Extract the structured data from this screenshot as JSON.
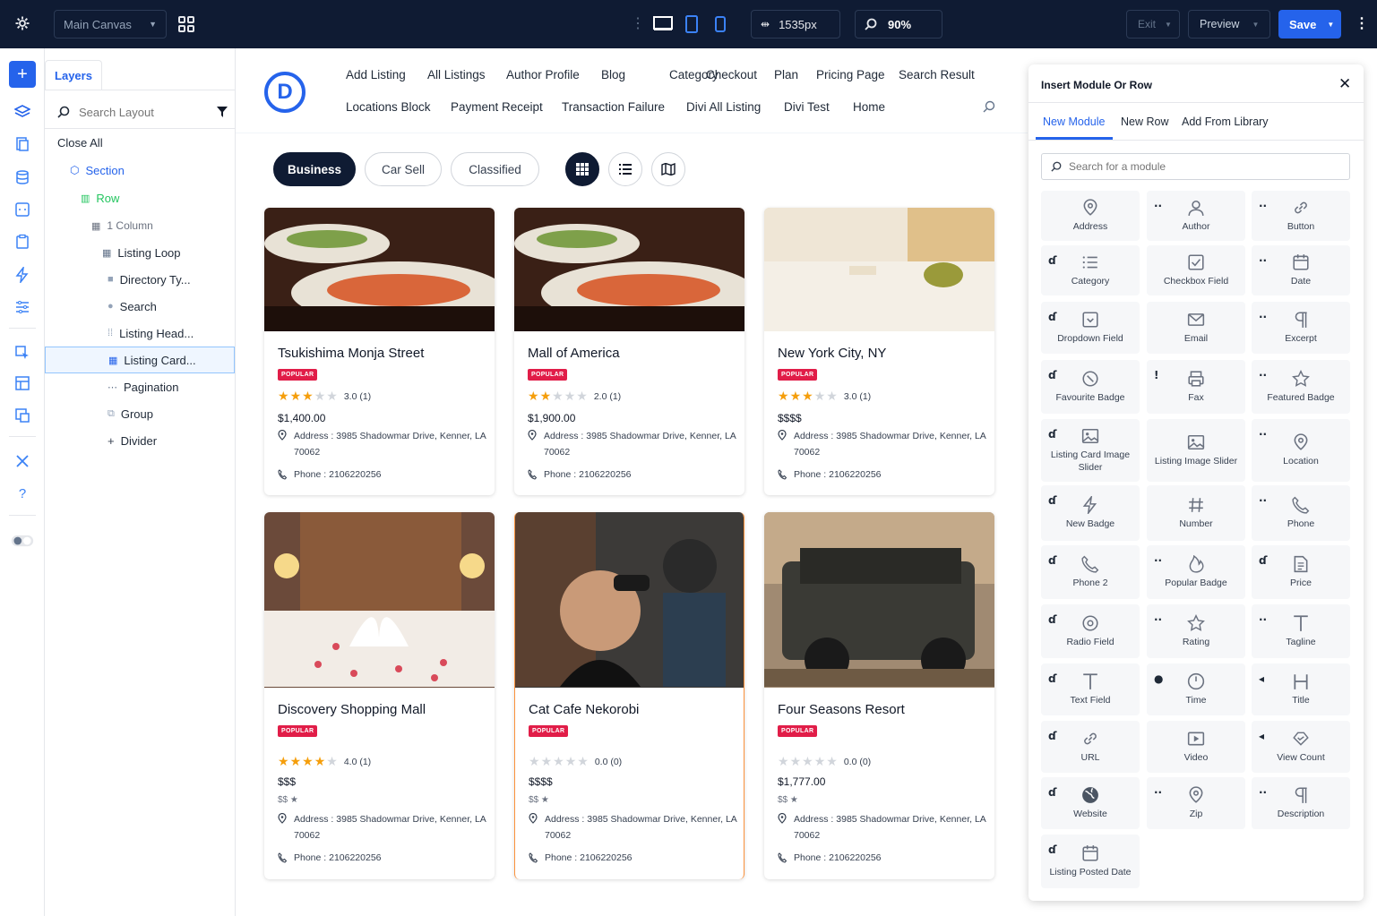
{
  "topbar": {
    "canvas_name": "Main Canvas",
    "width_value": "1535px",
    "zoom_value": "90%",
    "exit_label": "Exit",
    "preview_label": "Preview",
    "save_label": "Save"
  },
  "layers": {
    "tab_label": "Layers",
    "search_placeholder": "Search Layout",
    "close_all": "Close All",
    "items": [
      {
        "label": "Section"
      },
      {
        "label": "Row"
      },
      {
        "label": "1 Column"
      },
      {
        "label": "Listing Loop"
      },
      {
        "label": "Directory Ty..."
      },
      {
        "label": "Search"
      },
      {
        "label": "Listing Head..."
      },
      {
        "label": "Listing Card..."
      },
      {
        "label": "Pagination"
      },
      {
        "label": "Group"
      },
      {
        "label": "Divider"
      }
    ]
  },
  "logo": {
    "letter": "D"
  },
  "nav": {
    "row1": [
      "Add Listing",
      "All Listings",
      "Author Profile",
      "Blog",
      "Category",
      "Checkout",
      "Plan",
      "Pricing Page",
      "Search Result"
    ],
    "row2": [
      "Locations Block",
      "Payment Receipt",
      "Transaction Failure",
      "Divi All Listing",
      "Divi Test",
      "Home"
    ]
  },
  "filters": {
    "pills": [
      "Business",
      "Car Sell",
      "Classified"
    ]
  },
  "cards": [
    {
      "title": "Tsukishima Monja Street",
      "badge": "POPULAR",
      "rating": 3,
      "rating_text": "3.0 (1)",
      "price": "$1,400.00",
      "address": "Address : 3985 Shadowmar Drive, Kenner, LA 70062",
      "phone": "Phone : 2106220256"
    },
    {
      "title": "Mall of America",
      "badge": "POPULAR",
      "rating": 2,
      "rating_text": "2.0 (1)",
      "price": "$1,900.00",
      "address": "Address : 3985 Shadowmar Drive, Kenner, LA 70062",
      "phone": "Phone : 2106220256"
    },
    {
      "title": "New York City, NY",
      "badge": "POPULAR",
      "rating": 3,
      "rating_text": "3.0 (1)",
      "price": "$$$$",
      "address": "Address : 3985 Shadowmar Drive, Kenner, LA 70062",
      "phone": "Phone : 2106220256"
    },
    {
      "title": "Discovery Shopping Mall",
      "badge": "POPULAR",
      "rating": 4,
      "rating_text": "4.0 (1)",
      "price": "$$$",
      "price2": "$$ ★",
      "address": "Address : 3985 Shadowmar Drive, Kenner, LA 70062",
      "phone": "Phone : 2106220256"
    },
    {
      "title": "Cat Cafe Nekorobi",
      "badge": "POPULAR",
      "rating": 0,
      "rating_text": "0.0 (0)",
      "price": "$$$$",
      "price2": "$$ ★",
      "address": "Address : 3985 Shadowmar Drive, Kenner, LA 70062",
      "phone": "Phone : 2106220256"
    },
    {
      "title": "Four Seasons Resort",
      "badge": "POPULAR",
      "rating": 0,
      "rating_text": "0.0 (0)",
      "price": "$1,777.00",
      "price2": "$$ ★",
      "address": "Address : 3985 Shadowmar Drive, Kenner, LA 70062",
      "phone": "Phone : 2106220256"
    }
  ],
  "insert": {
    "title": "Insert Module Or Row",
    "tabs": [
      "New Module",
      "New Row",
      "Add From Library"
    ],
    "search_placeholder": "Search for a module",
    "modules": [
      {
        "label": "Address",
        "icon": "pin-icon"
      },
      {
        "label": "Author",
        "icon": "user-icon"
      },
      {
        "label": "Button",
        "icon": "link-icon"
      },
      {
        "label": "Category",
        "icon": "list-icon"
      },
      {
        "label": "Checkbox Field",
        "icon": "checkbox-icon"
      },
      {
        "label": "Date",
        "icon": "calendar-icon"
      },
      {
        "label": "Dropdown Field",
        "icon": "dropdown-icon"
      },
      {
        "label": "Email",
        "icon": "mail-icon"
      },
      {
        "label": "Excerpt",
        "icon": "paragraph-icon"
      },
      {
        "label": "Favourite Badge",
        "icon": "badge-icon"
      },
      {
        "label": "Fax",
        "icon": "printer-icon"
      },
      {
        "label": "Featured Badge",
        "icon": "star-icon"
      },
      {
        "label": "Listing Card Image Slider",
        "icon": "image-icon"
      },
      {
        "label": "Listing Image Slider",
        "icon": "image-icon"
      },
      {
        "label": "Location",
        "icon": "pin-icon"
      },
      {
        "label": "New Badge",
        "icon": "bolt-icon"
      },
      {
        "label": "Number",
        "icon": "hash-icon"
      },
      {
        "label": "Phone",
        "icon": "phone-icon"
      },
      {
        "label": "Phone 2",
        "icon": "phone-icon"
      },
      {
        "label": "Popular Badge",
        "icon": "fire-icon"
      },
      {
        "label": "Price",
        "icon": "document-icon"
      },
      {
        "label": "Radio Field",
        "icon": "radio-icon"
      },
      {
        "label": "Rating",
        "icon": "star-icon"
      },
      {
        "label": "Tagline",
        "icon": "text-icon"
      },
      {
        "label": "Text Field",
        "icon": "text-icon"
      },
      {
        "label": "Time",
        "icon": "clock-icon"
      },
      {
        "label": "Title",
        "icon": "heading-icon"
      },
      {
        "label": "URL",
        "icon": "link-icon"
      },
      {
        "label": "Video",
        "icon": "video-icon"
      },
      {
        "label": "View Count",
        "icon": "eye-icon"
      },
      {
        "label": "Website",
        "icon": "globe-icon"
      },
      {
        "label": "Zip",
        "icon": "pin-icon"
      },
      {
        "label": "Description",
        "icon": "paragraph-icon"
      },
      {
        "label": "Listing Posted Date",
        "icon": "calendar-icon"
      }
    ]
  },
  "colors": {
    "accent": "#2563eb",
    "topbar": "#0f1b33",
    "badge": "#e11d48",
    "star": "#f59e0b"
  }
}
